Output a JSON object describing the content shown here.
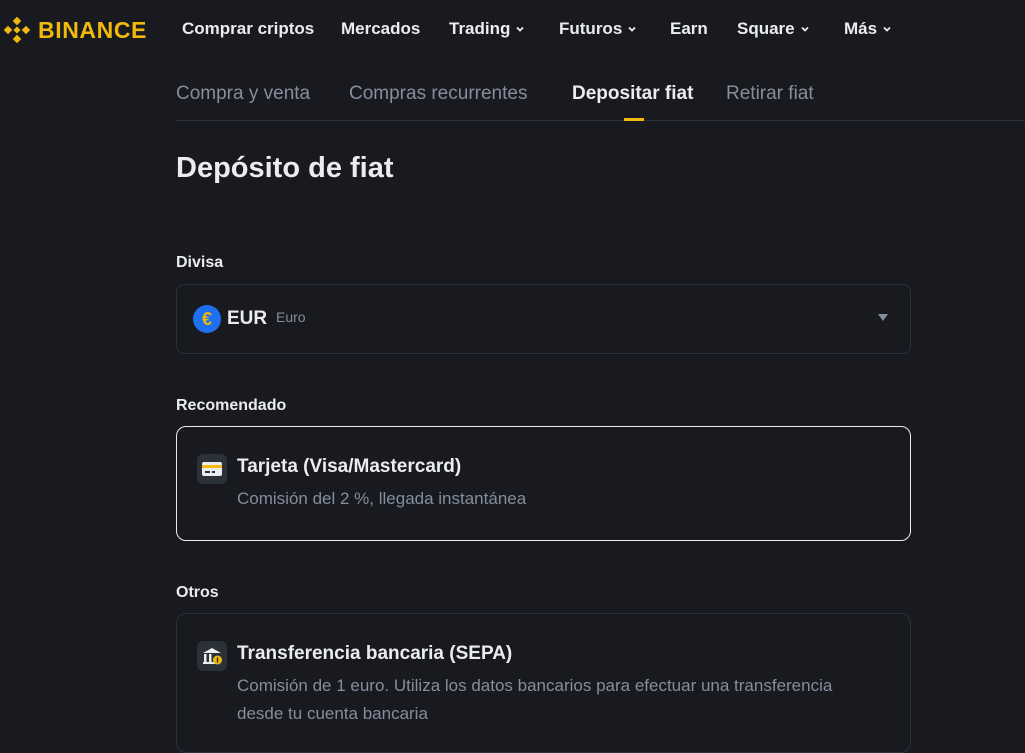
{
  "brand": {
    "name": "BINANCE",
    "color": "#f0b90b",
    "logo_icon": "binance-logo-icon"
  },
  "nav": {
    "items": [
      {
        "label": "Comprar criptos",
        "dropdown": false
      },
      {
        "label": "Mercados",
        "dropdown": false
      },
      {
        "label": "Trading",
        "dropdown": true
      },
      {
        "label": "Futuros",
        "dropdown": true
      },
      {
        "label": "Earn",
        "dropdown": false
      },
      {
        "label": "Square",
        "dropdown": true
      },
      {
        "label": "Más",
        "dropdown": true
      }
    ]
  },
  "subtabs": {
    "items": [
      {
        "label": "Compra y venta",
        "active": false
      },
      {
        "label": "Compras recurrentes",
        "active": false
      },
      {
        "label": "Depositar fiat",
        "active": true
      },
      {
        "label": "Retirar fiat",
        "active": false
      }
    ]
  },
  "page": {
    "title": "Depósito de fiat"
  },
  "currency": {
    "label": "Divisa",
    "selected_code": "EUR",
    "selected_name": "Euro",
    "icon_symbol": "€"
  },
  "recommended": {
    "label": "Recomendado",
    "method": {
      "title": "Tarjeta (Visa/Mastercard)",
      "description": "Comisión del 2 %, llegada instantánea",
      "icon": "credit-card-icon"
    }
  },
  "others": {
    "label": "Otros",
    "method": {
      "title": "Transferencia bancaria (SEPA)",
      "description_line1": "Comisión de 1 euro. Utiliza los datos bancarios para efectuar una transferencia",
      "description_line2": "desde tu cuenta bancaria",
      "icon": "bank-icon"
    }
  },
  "colors": {
    "background": "#181a20",
    "accent": "#f0b90b",
    "text_primary": "#eaecef",
    "text_secondary": "#848e9c",
    "border": "#2b3139"
  }
}
